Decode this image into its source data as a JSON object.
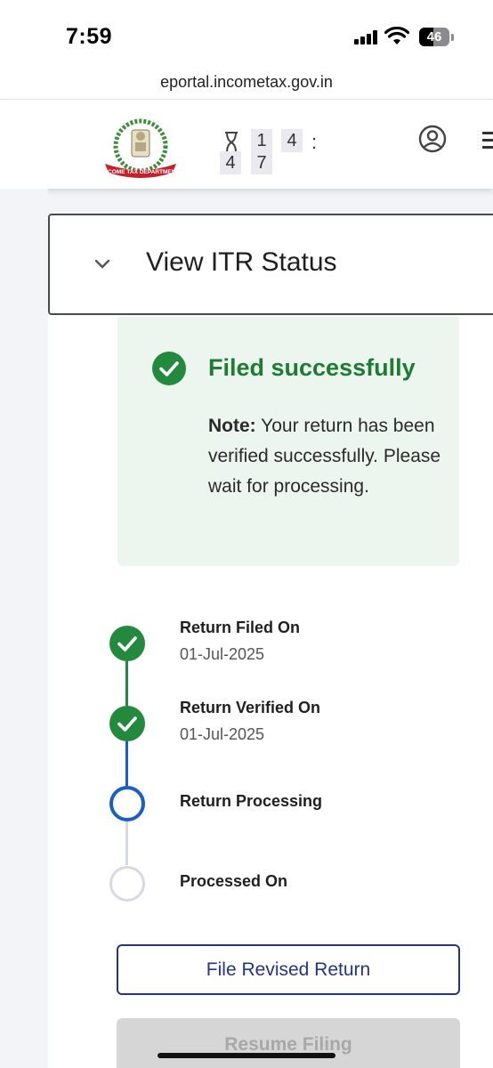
{
  "status_bar": {
    "time": "7:59",
    "battery": "46",
    "battery_level": 0.46
  },
  "browser": {
    "url": "eportal.incometax.gov.in"
  },
  "header": {
    "logo_text": "INCOME TAX DEPARTMENT",
    "timer": {
      "digits": [
        "1",
        "4",
        "4",
        "7"
      ],
      "colon": ":"
    },
    "icons": [
      "hourglass-icon",
      "profile-icon",
      "menu-icon"
    ]
  },
  "accordion": {
    "title": "View ITR Status"
  },
  "status_box": {
    "title": "Filed successfully",
    "note_label": "Note:",
    "note_text": "Your return has been verified successfully. Please wait for processing."
  },
  "timeline": [
    {
      "label": "Return Filed On",
      "date": "01-Jul-2025",
      "state": "done"
    },
    {
      "label": "Return Verified On",
      "date": "01-Jul-2025",
      "state": "done"
    },
    {
      "label": "Return Processing",
      "date": "",
      "state": "current"
    },
    {
      "label": "Processed On",
      "date": "",
      "state": "pending"
    }
  ],
  "buttons": {
    "file_revised": "File Revised Return",
    "resume_filing": "Resume Filing"
  },
  "colors": {
    "success_green": "#1e7b34",
    "done_node": "#238a3d",
    "current_blue": "#1a5fc4",
    "primary_navy": "#22358a",
    "success_bg": "#edf6ee"
  }
}
